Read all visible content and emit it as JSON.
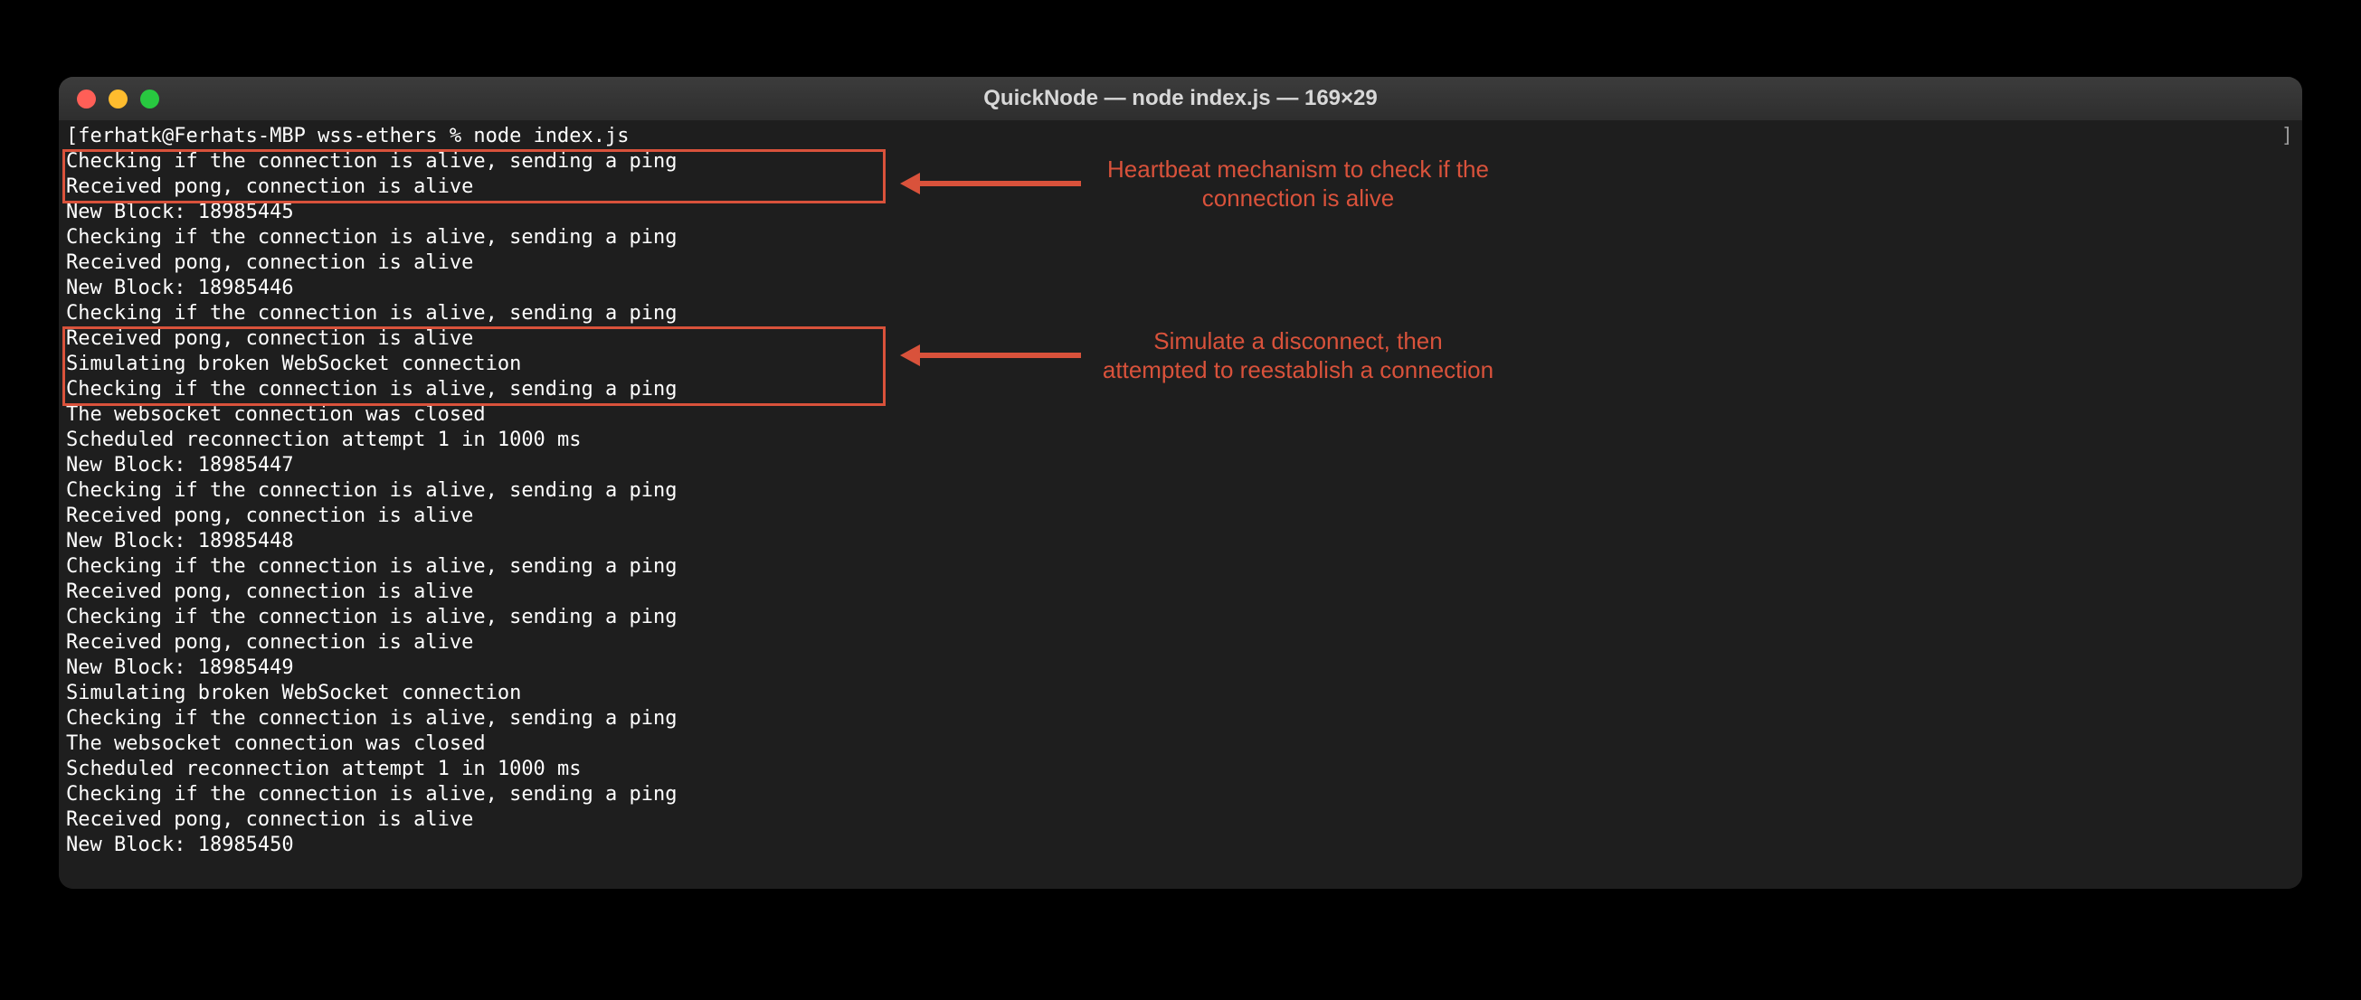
{
  "titlebar": {
    "title": "QuickNode — node index.js — 169×29"
  },
  "annotations": {
    "note1": "Heartbeat mechanism to check if the connection is alive",
    "note2": "Simulate a disconnect, then attempted to reestablish a connection"
  },
  "prompt": {
    "bracket": "[",
    "text": "ferhatk@Ferhats-MBP wss-ethers % node index.js"
  },
  "terminal_lines": [
    "Checking if the connection is alive, sending a ping",
    "Received pong, connection is alive",
    "New Block: 18985445",
    "Checking if the connection is alive, sending a ping",
    "Received pong, connection is alive",
    "New Block: 18985446",
    "Checking if the connection is alive, sending a ping",
    "Received pong, connection is alive",
    "Simulating broken WebSocket connection",
    "Checking if the connection is alive, sending a ping",
    "The websocket connection was closed",
    "Scheduled reconnection attempt 1 in 1000 ms",
    "New Block: 18985447",
    "Checking if the connection is alive, sending a ping",
    "Received pong, connection is alive",
    "New Block: 18985448",
    "Checking if the connection is alive, sending a ping",
    "Received pong, connection is alive",
    "Checking if the connection is alive, sending a ping",
    "Received pong, connection is alive",
    "New Block: 18985449",
    "Simulating broken WebSocket connection",
    "Checking if the connection is alive, sending a ping",
    "The websocket connection was closed",
    "Scheduled reconnection attempt 1 in 1000 ms",
    "Checking if the connection is alive, sending a ping",
    "Received pong, connection is alive",
    "New Block: 18985450"
  ],
  "cursor_bracket": "]"
}
